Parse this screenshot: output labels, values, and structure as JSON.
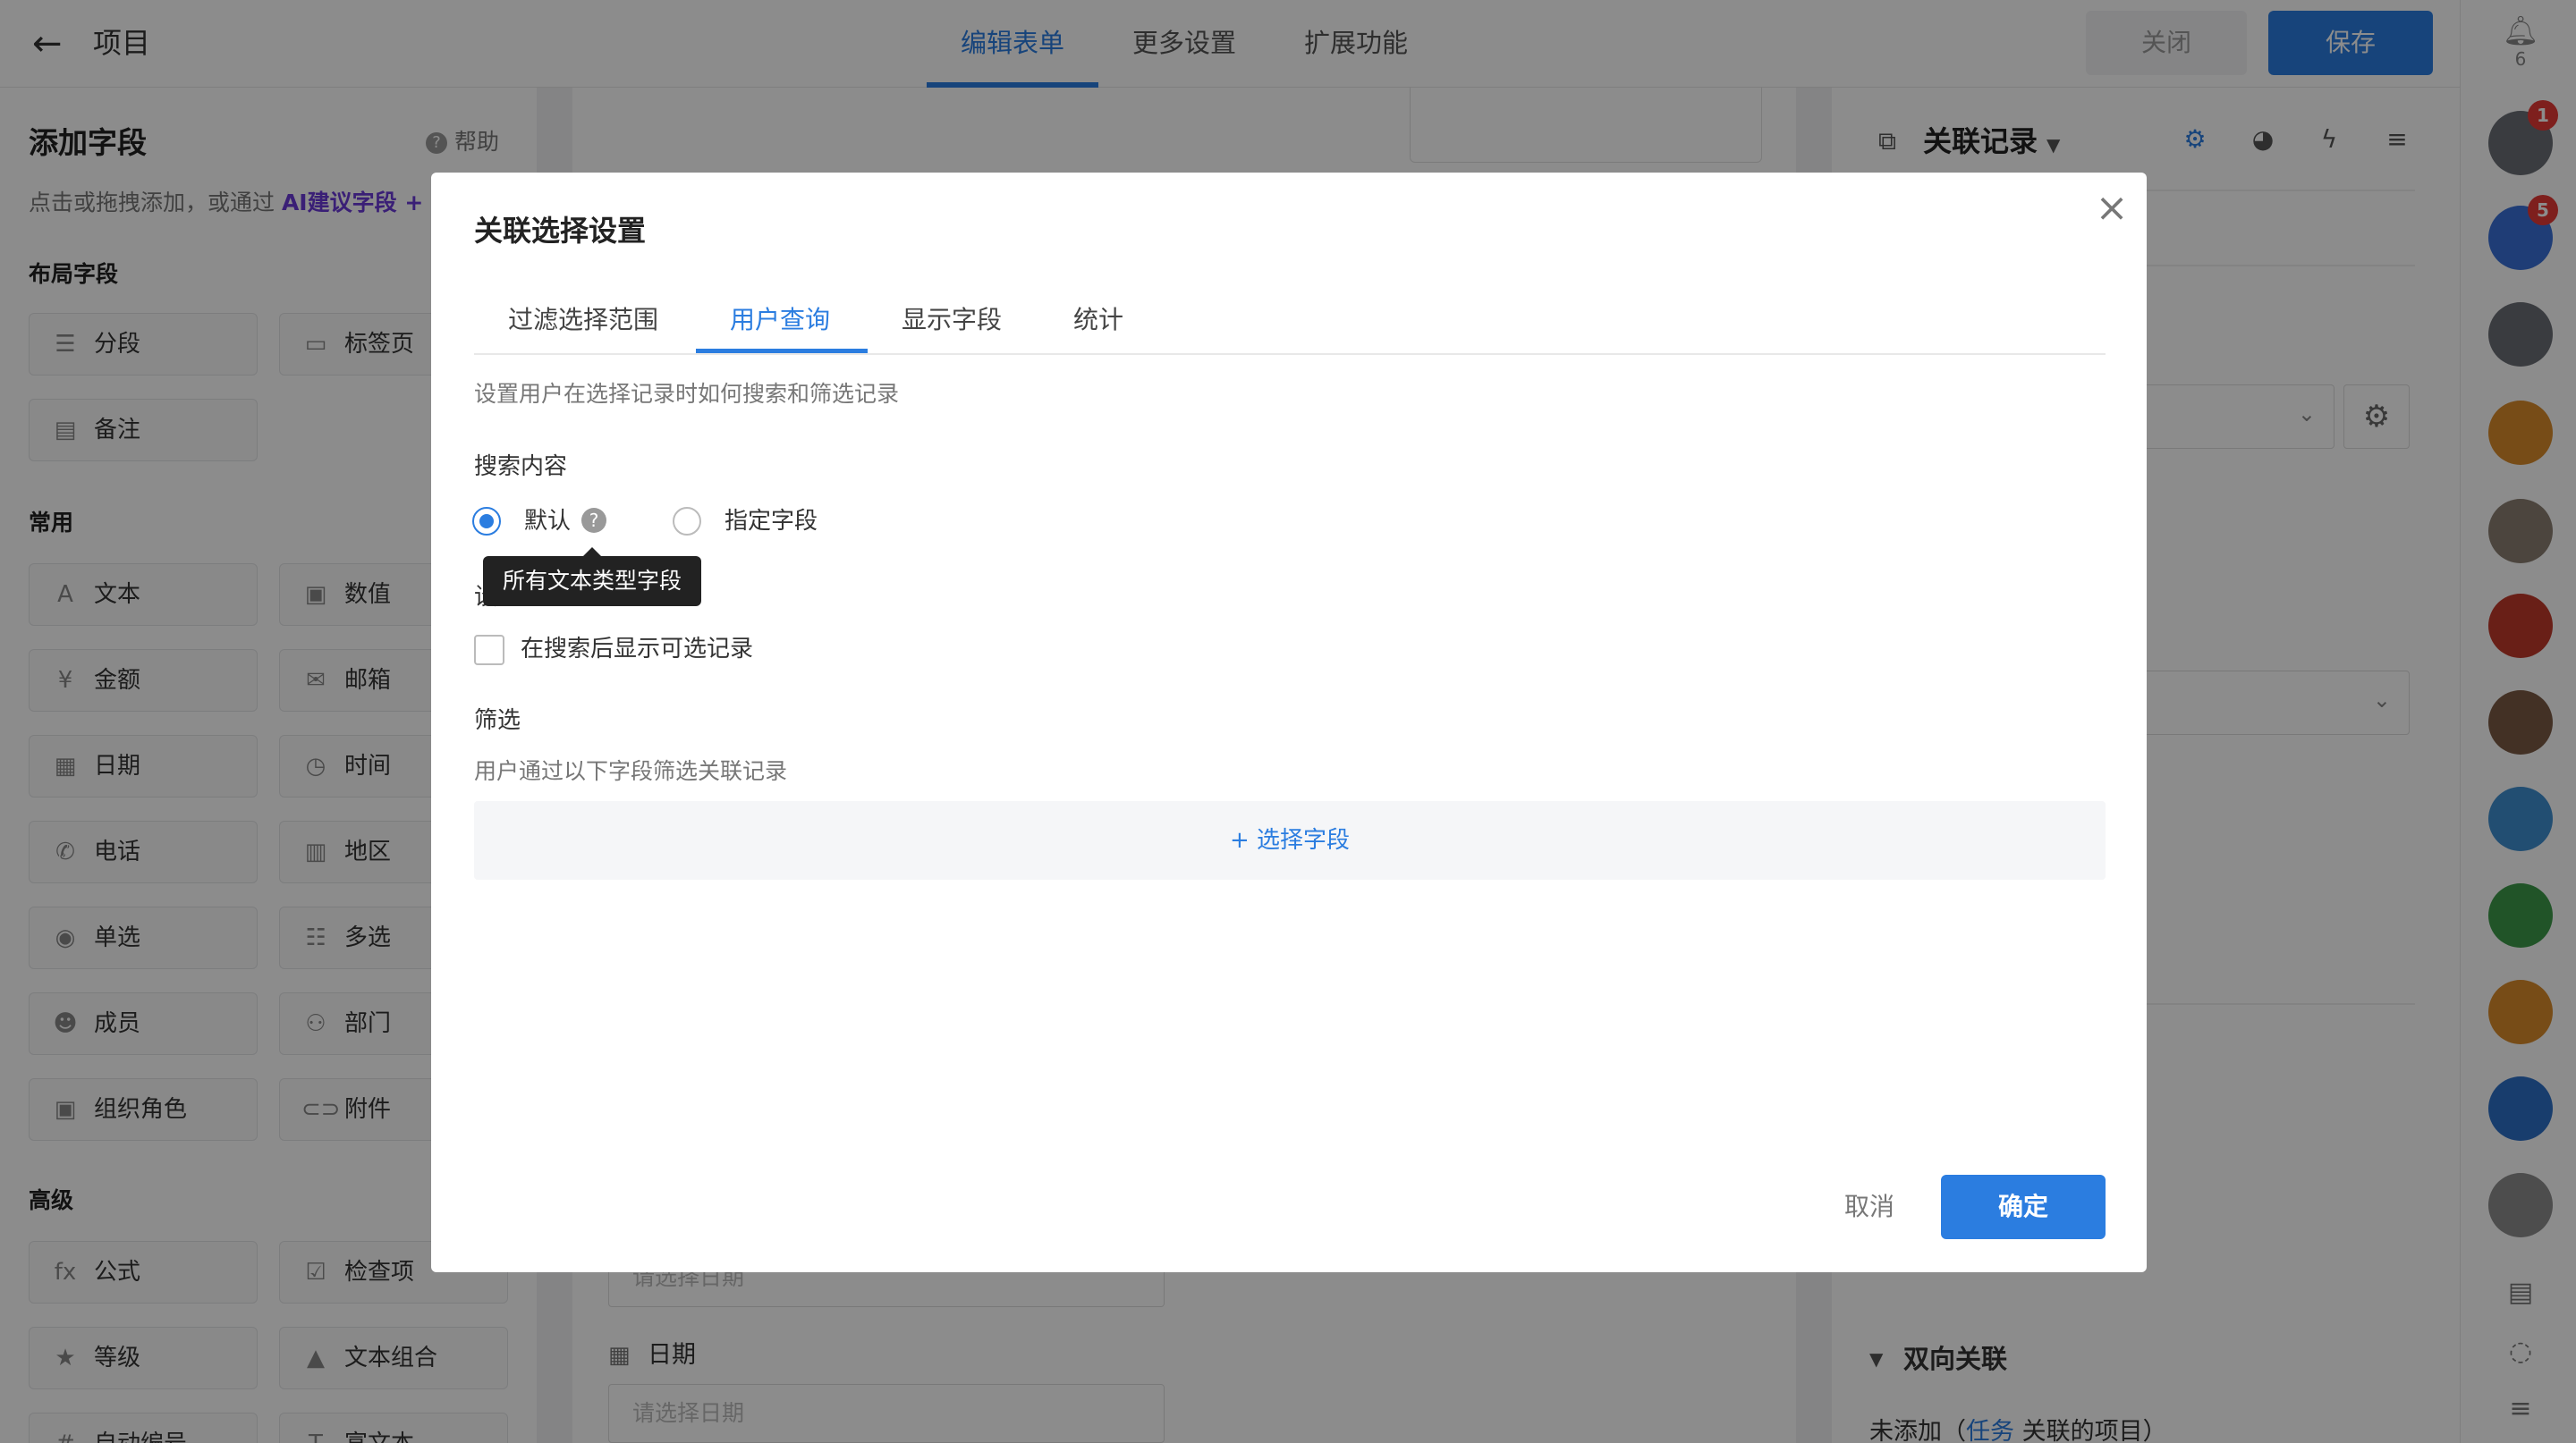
{
  "topbar": {
    "title": "项目",
    "tabs": [
      "编辑表单",
      "更多设置",
      "扩展功能"
    ],
    "close_label": "关闭",
    "save_label": "保存"
  },
  "left_panel": {
    "title": "添加字段",
    "help": "帮助",
    "desc_prefix": "点击或拖拽添加，或通过 ",
    "desc_link": "AI建议字段",
    "desc_suffix": " +",
    "sections": {
      "layout": "布局字段",
      "common": "常用",
      "advanced": "高级"
    },
    "layout_fields": [
      "分段",
      "标签页",
      "备注"
    ],
    "common_fields": [
      "文本",
      "数值",
      "金额",
      "邮箱",
      "日期",
      "时间",
      "电话",
      "地区",
      "单选",
      "多选",
      "成员",
      "部门",
      "组织角色",
      "附件"
    ],
    "advanced_fields": [
      "公式",
      "检查项",
      "等级",
      "文本组合",
      "自动编号",
      "富文本"
    ]
  },
  "center": {
    "date_placeholder_1": "请选择日期",
    "date_label": "日期",
    "date_placeholder_2": "请选择日期"
  },
  "right_panel": {
    "title": "关联记录",
    "section": "双向关联",
    "bottom_prefix": "未添加（",
    "bottom_link": "任务",
    "bottom_suffix": " 关联的项目）"
  },
  "sidebar": {
    "bell_count": "6",
    "badge_1": "1",
    "badge_2": "5"
  },
  "modal": {
    "title": "关联选择设置",
    "tabs": [
      "过滤选择范围",
      "用户查询",
      "显示字段",
      "统计"
    ],
    "description": "设置用户在选择记录时如何搜索和筛选记录",
    "search_heading": "搜索内容",
    "radio_default": "默认",
    "radio_specific": "指定字段",
    "tooltip": "所有文本类型字段",
    "settings_heading_partial": "设",
    "checkbox_label": "在搜索后显示可选记录",
    "filter_heading": "筛选",
    "filter_desc": "用户通过以下字段筛选关联记录",
    "add_field": "+ 选择字段",
    "cancel": "取消",
    "confirm": "确定"
  },
  "colors": {
    "accent": "#2b7de0",
    "overlay": "rgba(0,0,0,0.45)",
    "badge": "#e53935"
  }
}
